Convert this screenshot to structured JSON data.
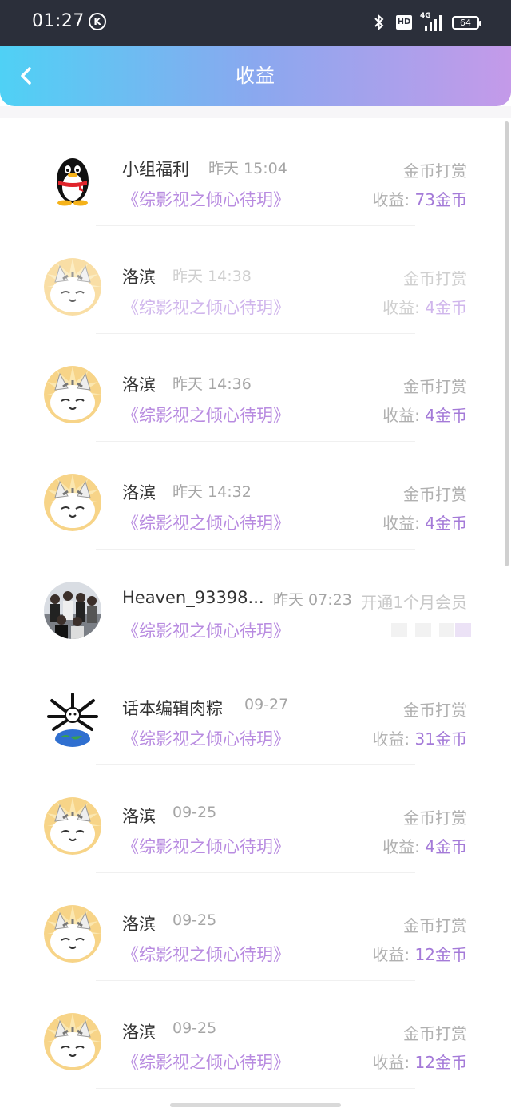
{
  "status_bar": {
    "time": "01:27",
    "k_badge": "K",
    "hd": "HD",
    "network": "4G",
    "battery": "64"
  },
  "header": {
    "title": "收益"
  },
  "list": [
    {
      "name": "小组福利",
      "time": "昨天 15:04",
      "book": "《综影视之倾心待玥》",
      "type": "金币打赏",
      "earn_label": "收益:",
      "earn_amount": "73金币",
      "avatar": "qq-penguin-icon"
    },
    {
      "name": "洛滨",
      "time": "昨天 14:38",
      "book": "《综影视之倾心待玥》",
      "type": "金币打赏",
      "earn_label": "收益:",
      "earn_amount": "4金币",
      "avatar": "cartoon-cat-icon"
    },
    {
      "name": "洛滨",
      "time": "昨天 14:36",
      "book": "《综影视之倾心待玥》",
      "type": "金币打赏",
      "earn_label": "收益:",
      "earn_amount": "4金币",
      "avatar": "cartoon-cat-icon"
    },
    {
      "name": "洛滨",
      "time": "昨天 14:32",
      "book": "《综影视之倾心待玥》",
      "type": "金币打赏",
      "earn_label": "收益:",
      "earn_amount": "4金币",
      "avatar": "cartoon-cat-icon"
    },
    {
      "name": "Heaven_93398...",
      "time": "昨天 07:23",
      "book": "《综影视之倾心待玥》",
      "type": "开通1个月会员",
      "earn_label": "",
      "earn_amount": "",
      "avatar": "group-photo-icon"
    },
    {
      "name": "话本编辑肉粽",
      "time": "09-27",
      "book": "《综影视之倾心待玥》",
      "type": "金币打赏",
      "earn_label": "收益:",
      "earn_amount": "31金币",
      "avatar": "earth-skull-icon"
    },
    {
      "name": "洛滨",
      "time": "09-25",
      "book": "《综影视之倾心待玥》",
      "type": "金币打赏",
      "earn_label": "收益:",
      "earn_amount": "4金币",
      "avatar": "cartoon-cat-icon"
    },
    {
      "name": "洛滨",
      "time": "09-25",
      "book": "《综影视之倾心待玥》",
      "type": "金币打赏",
      "earn_label": "收益:",
      "earn_amount": "12金币",
      "avatar": "cartoon-cat-icon"
    },
    {
      "name": "洛滨",
      "time": "09-25",
      "book": "《综影视之倾心待玥》",
      "type": "金币打赏",
      "earn_label": "收益:",
      "earn_amount": "12金币",
      "avatar": "cartoon-cat-icon"
    }
  ]
}
